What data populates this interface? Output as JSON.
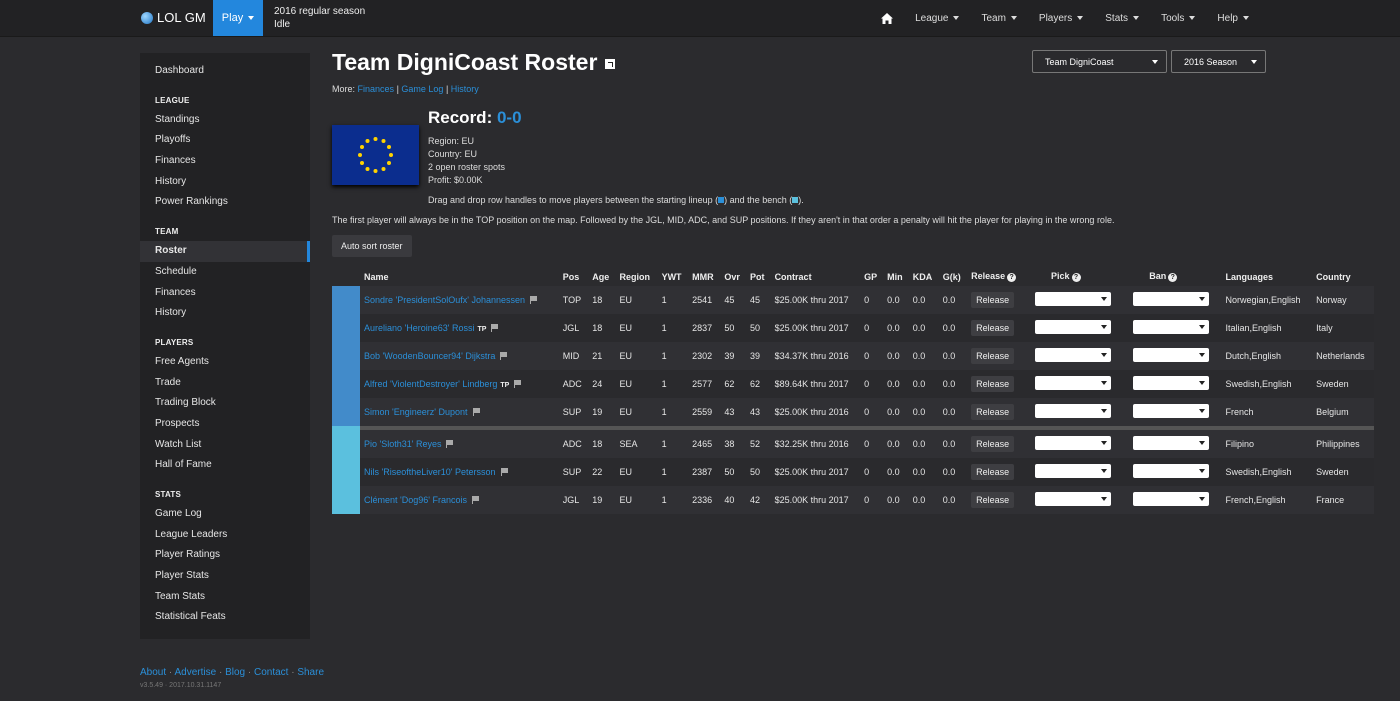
{
  "navbar": {
    "brand": "LOL GM",
    "play_label": "Play",
    "season": "2016 regular season",
    "status": "Idle",
    "menu": [
      "League",
      "Team",
      "Players",
      "Stats",
      "Tools",
      "Help"
    ]
  },
  "sidebar": {
    "dashboard": "Dashboard",
    "league_head": "LEAGUE",
    "league_items": [
      "Standings",
      "Playoffs",
      "Finances",
      "History",
      "Power Rankings"
    ],
    "team_head": "TEAM",
    "team_items": [
      "Roster",
      "Schedule",
      "Finances",
      "History"
    ],
    "players_head": "PLAYERS",
    "players_items": [
      "Free Agents",
      "Trade",
      "Trading Block",
      "Prospects",
      "Watch List",
      "Hall of Fame"
    ],
    "stats_head": "STATS",
    "stats_items": [
      "Game Log",
      "League Leaders",
      "Player Ratings",
      "Player Stats",
      "Team Stats",
      "Statistical Feats"
    ]
  },
  "footer": {
    "links": [
      "About",
      "Advertise",
      "Blog",
      "Contact",
      "Share"
    ],
    "version": "v3.5.49 · 2017.10.31.1147"
  },
  "page": {
    "title": "Team DigniCoast Roster",
    "more_label": "More:",
    "more_links": [
      "Finances",
      "Game Log",
      "History"
    ],
    "team_select": "Team DigniCoast",
    "season_select": "2016 Season",
    "record_label": "Record:",
    "record_value": "0-0",
    "region": "Region: EU",
    "country": "Country: EU",
    "open_spots": "2 open roster spots",
    "profit": "Profit: $0.00K",
    "drag_note_a": "Drag and drop row handles to move players between the starting lineup (",
    "drag_note_b": ") and the bench (",
    "drag_note_c": ").",
    "first_note": "The first player will always be in the TOP position on the map. Followed by the JGL, MID, ADC, and SUP positions. If they aren't in that order a penalty will hit the player for playing in the wrong role.",
    "auto_sort": "Auto sort roster",
    "release_label": "Release"
  },
  "table": {
    "headers": [
      "Name",
      "Pos",
      "Age",
      "Region",
      "YWT",
      "MMR",
      "Ovr",
      "Pot",
      "Contract",
      "GP",
      "Min",
      "KDA",
      "G(k)",
      "Release",
      "Pick",
      "Ban",
      "Languages",
      "Country"
    ],
    "rows": [
      {
        "name": "Sondre 'PresidentSolOufx' Johannessen",
        "tag": "",
        "pos": "TOP",
        "age": "18",
        "region": "EU",
        "ywt": "1",
        "mmr": "2541",
        "ovr": "45",
        "pot": "45",
        "contract": "$25.00K thru 2017",
        "gp": "0",
        "min": "0.0",
        "kda": "0.0",
        "gk": "0.0",
        "languages": "Norwegian,English",
        "country": "Norway"
      },
      {
        "name": "Aureliano 'Heroine63' Rossi",
        "tag": "TP",
        "pos": "JGL",
        "age": "18",
        "region": "EU",
        "ywt": "1",
        "mmr": "2837",
        "ovr": "50",
        "pot": "50",
        "contract": "$25.00K thru 2017",
        "gp": "0",
        "min": "0.0",
        "kda": "0.0",
        "gk": "0.0",
        "languages": "Italian,English",
        "country": "Italy"
      },
      {
        "name": "Bob 'WoodenBouncer94' Dijkstra",
        "tag": "",
        "pos": "MID",
        "age": "21",
        "region": "EU",
        "ywt": "1",
        "mmr": "2302",
        "ovr": "39",
        "pot": "39",
        "contract": "$34.37K thru 2016",
        "gp": "0",
        "min": "0.0",
        "kda": "0.0",
        "gk": "0.0",
        "languages": "Dutch,English",
        "country": "Netherlands"
      },
      {
        "name": "Alfred 'ViolentDestroyer' Lindberg",
        "tag": "TP",
        "pos": "ADC",
        "age": "24",
        "region": "EU",
        "ywt": "1",
        "mmr": "2577",
        "ovr": "62",
        "pot": "62",
        "contract": "$89.64K thru 2017",
        "gp": "0",
        "min": "0.0",
        "kda": "0.0",
        "gk": "0.0",
        "languages": "Swedish,English",
        "country": "Sweden"
      },
      {
        "name": "Simon 'Engineerz' Dupont",
        "tag": "",
        "pos": "SUP",
        "age": "19",
        "region": "EU",
        "ywt": "1",
        "mmr": "2559",
        "ovr": "43",
        "pot": "43",
        "contract": "$25.00K thru 2016",
        "gp": "0",
        "min": "0.0",
        "kda": "0.0",
        "gk": "0.0",
        "languages": "French",
        "country": "Belgium"
      },
      {
        "name": "Pio 'Sloth31' Reyes",
        "tag": "",
        "pos": "ADC",
        "age": "18",
        "region": "SEA",
        "ywt": "1",
        "mmr": "2465",
        "ovr": "38",
        "pot": "52",
        "contract": "$32.25K thru 2016",
        "gp": "0",
        "min": "0.0",
        "kda": "0.0",
        "gk": "0.0",
        "languages": "Filipino",
        "country": "Philippines"
      },
      {
        "name": "Nils 'RiseoftheLiver10' Petersson",
        "tag": "",
        "pos": "SUP",
        "age": "22",
        "region": "EU",
        "ywt": "1",
        "mmr": "2387",
        "ovr": "50",
        "pot": "50",
        "contract": "$25.00K thru 2017",
        "gp": "0",
        "min": "0.0",
        "kda": "0.0",
        "gk": "0.0",
        "languages": "Swedish,English",
        "country": "Sweden"
      },
      {
        "name": "Clément 'Dog96' Francois",
        "tag": "",
        "pos": "JGL",
        "age": "19",
        "region": "EU",
        "ywt": "1",
        "mmr": "2336",
        "ovr": "40",
        "pot": "42",
        "contract": "$25.00K thru 2017",
        "gp": "0",
        "min": "0.0",
        "kda": "0.0",
        "gk": "0.0",
        "languages": "French,English",
        "country": "France"
      }
    ]
  },
  "colors": {
    "accent": "#2387dd",
    "starter_handle": "#428bca",
    "bench_handle": "#5bc0de",
    "link": "#2b8fd8",
    "flag_blue": "#0b2d8e",
    "flag_star": "#ffd200"
  }
}
